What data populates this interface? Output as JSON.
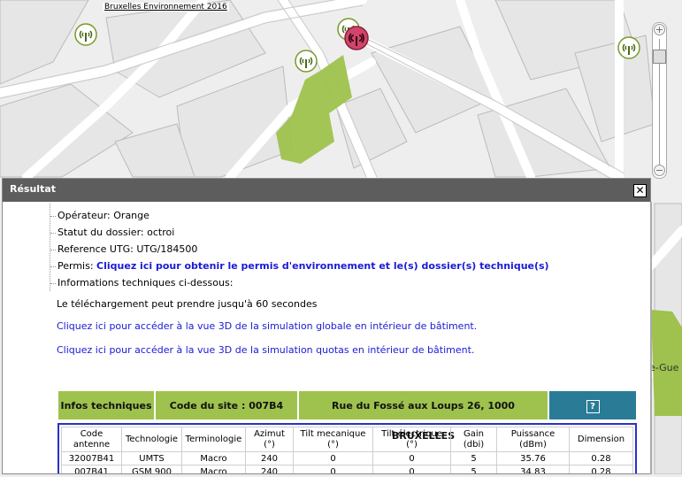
{
  "map": {
    "copyright": "Bruxelles Environnement 2016",
    "street_label": "e-Gue",
    "colors": {
      "park": "#9ec24d",
      "road": "#ffffff",
      "block": "#e8e8e8",
      "antenna": "#7a9a2a",
      "selected": "#d2456a"
    }
  },
  "zoom": {
    "plus_label": "+",
    "minus_label": "−"
  },
  "panel": {
    "title": "Résultat",
    "close_label": "✕",
    "tree": [
      {
        "label": "Opérateur:",
        "value": "Orange"
      },
      {
        "label": "Statut du dossier:",
        "value": "octroi"
      },
      {
        "label": "Reference UTG:",
        "value": "UTG/184500"
      },
      {
        "label": "Permis:",
        "link": "Cliquez ici pour obtenir le permis d'environnement et le(s) dossier(s) technique(s)"
      },
      {
        "label": "Informations techniques ci-dessous:"
      }
    ],
    "download_note": "Le téléchargement peut prendre jusqu'à 60 secondes",
    "link_3d_global": "Cliquez ici pour accéder à la vue 3D de la simulation globale en intérieur de bâtiment.",
    "link_3d_quotas": "Cliquez ici pour accéder à la vue 3D de la simulation quotas en intérieur de bâtiment.",
    "info_bar": {
      "infos": "Infos techniques",
      "site_code": "Code du site : 007B4",
      "address": "Rue du Fossé aux Loups 26, 1000 BRUXELLES",
      "help": "?"
    },
    "table": {
      "headers": [
        [
          "Code",
          "antenne"
        ],
        [
          "Technologie"
        ],
        [
          "Terminologie"
        ],
        [
          "Azimut",
          "(°)"
        ],
        [
          "Tilt mecanique",
          "(°)"
        ],
        [
          "Tilt électrique",
          "(°)"
        ],
        [
          "Gain",
          "(dbi)"
        ],
        [
          "Puissance",
          "(dBm)"
        ],
        [
          "Dimension"
        ]
      ],
      "rows": [
        [
          "32007B41",
          "UMTS",
          "Macro",
          "240",
          "0",
          "0",
          "5",
          "35.76",
          "0.28"
        ],
        [
          "007B41",
          "GSM 900",
          "Macro",
          "240",
          "0",
          "0",
          "5",
          "34.83",
          "0.28"
        ]
      ]
    }
  }
}
